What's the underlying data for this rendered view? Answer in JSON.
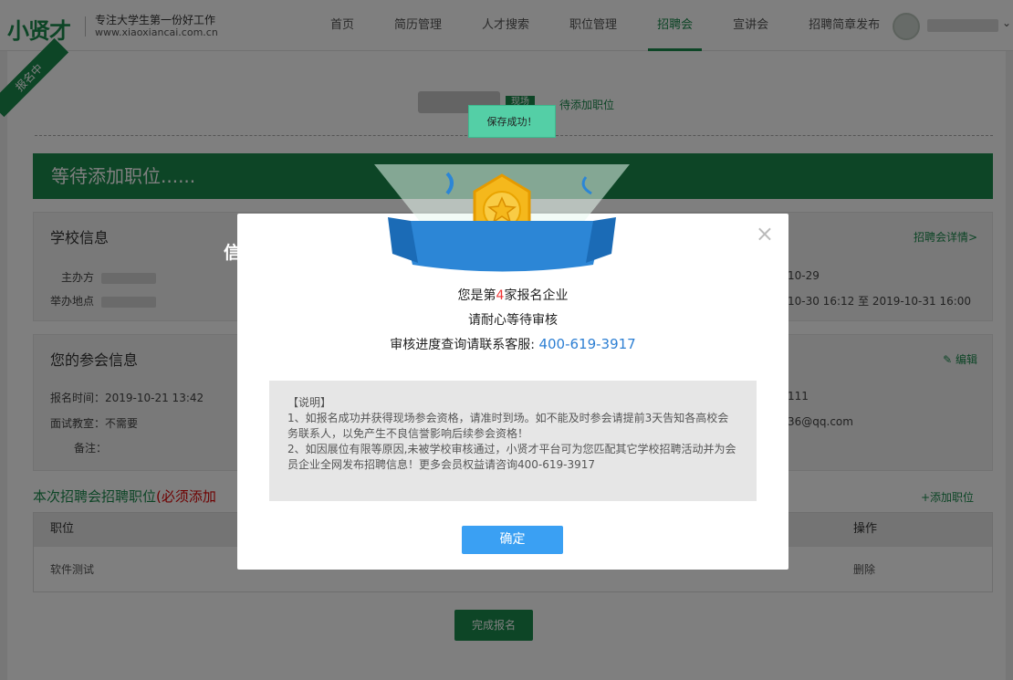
{
  "header": {
    "logo": "小贤才",
    "slogan": "专注大学生第一份好工作",
    "url": "www.xiaoxiancai.com.cn",
    "nav": [
      "首页",
      "简历管理",
      "人才搜索",
      "职位管理",
      "招聘会",
      "宣讲会",
      "招聘简章发布"
    ],
    "active_nav": "招聘会"
  },
  "event": {
    "ribbon": "报名中",
    "tag": "现场",
    "status": "待添加职位"
  },
  "banner": "等待添加职位......",
  "school": {
    "title": "学校信息",
    "detail_link": "招聘会详情>",
    "host_label": "主办方",
    "place_label": "举办地点",
    "date": "10-29",
    "time": "10-30 16:12 至 2019-10-31 16:00"
  },
  "attend": {
    "title": "您的参会信息",
    "edit_link": "编辑",
    "signup_time": "报名时间：2019-10-21 13:42",
    "classroom": "面试教室：不需要",
    "remark": "备注：",
    "phone_tail": "111",
    "email_tail": "36@qq.com"
  },
  "positions": {
    "title": "本次招聘会招聘职位",
    "required": "(必须添加",
    "add_link": "+添加职位",
    "col_position": "职位",
    "col_action": "操作",
    "rows": [
      {
        "position": "软件测试",
        "action": "删除"
      }
    ]
  },
  "submit": "完成报名",
  "toast": "保存成功！",
  "modal": {
    "title": "信息提交成功",
    "line1_pre": "您是第",
    "line1_num": "4",
    "line1_post": "家报名企业",
    "line2": "请耐心等待审核",
    "line3_pre": "审核进度查询请联系客服: ",
    "phone": "400-619-3917",
    "note_head": "【说明】",
    "note_1": "1、如报名成功并获得现场参会资格，请准时到场。如不能及时参会请提前3天告知各高校会务联系人，以免产生不良信誉影响后续参会资格！",
    "note_2": "2、如因展位有限等原因,未被学校审核通过，小贤才平台可为您匹配其它学校招聘活动并为会员企业全网发布招聘信息！更多会员权益请咨询400-619-3917",
    "ok": "确定",
    "close": "×"
  }
}
